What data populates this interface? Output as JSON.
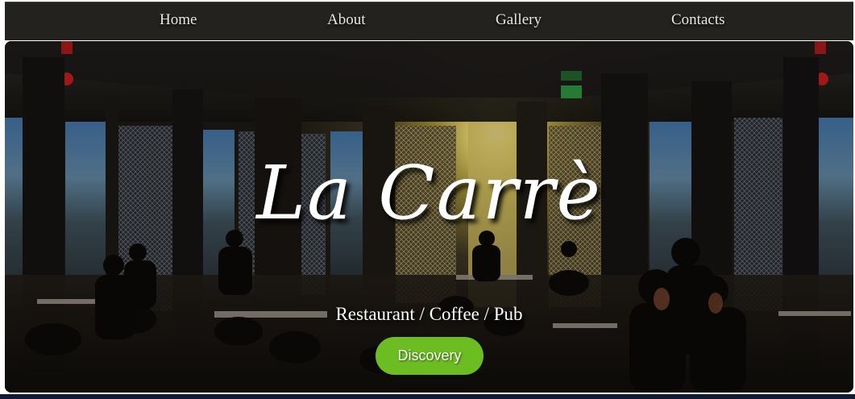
{
  "nav": {
    "items": [
      {
        "label": "Home"
      },
      {
        "label": "About"
      },
      {
        "label": "Gallery"
      },
      {
        "label": "Contacts"
      }
    ]
  },
  "hero": {
    "title": "La Carrè",
    "subtitle": "Restaurant / Coffee / Pub",
    "cta_label": "Discovery"
  },
  "colors": {
    "nav_background": "#23221f",
    "cta_background": "#6cbd22",
    "hero_text": "#ffffff"
  },
  "icons": {
    "hero_image": "restaurant-interior-image",
    "exit_sign": "exit-sign-icon"
  }
}
